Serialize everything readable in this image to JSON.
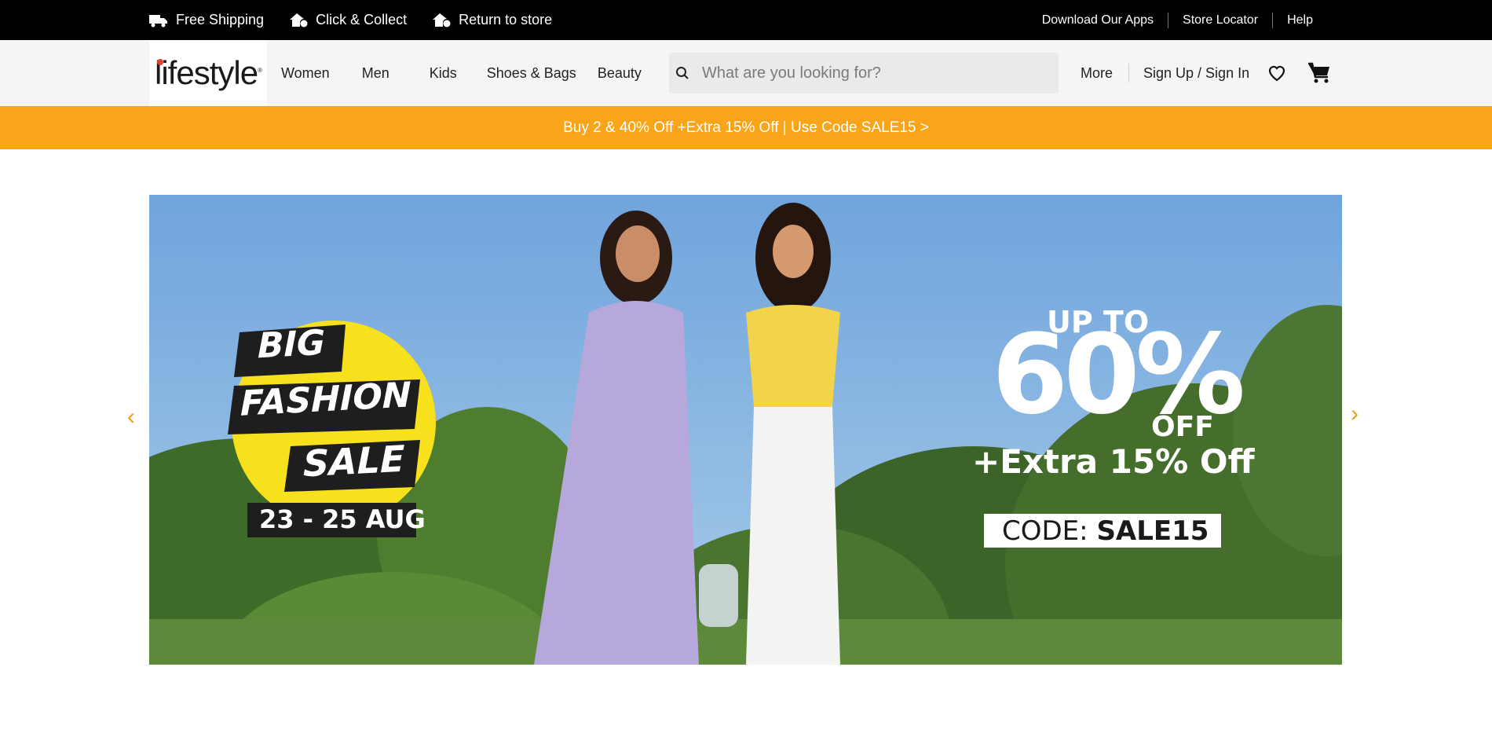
{
  "topbar": {
    "perks": [
      {
        "label": "Free Shipping",
        "icon": "truck-icon"
      },
      {
        "label": "Click & Collect",
        "icon": "home-check-icon"
      },
      {
        "label": "Return to store",
        "icon": "home-return-icon"
      }
    ],
    "links": [
      "Download Our Apps",
      "Store Locator",
      "Help"
    ]
  },
  "header": {
    "logo": "lifestyle",
    "nav": [
      "Women",
      "Men",
      "Kids",
      "Shoes & Bags",
      "Beauty"
    ],
    "search_placeholder": "What are you looking for?",
    "more": "More",
    "signin": "Sign Up / Sign In",
    "icons": [
      "heart-icon",
      "cart-icon"
    ]
  },
  "promo": {
    "text": "Buy 2 & 40% Off +Extra 15% Off | Use Code SALE15 >",
    "color": "#f9a51a"
  },
  "hero": {
    "badge_lines": [
      "BIG",
      "FASHION",
      "SALE"
    ],
    "dates": "23 - 25 AUG",
    "up_to": "UP TO",
    "percent": "60%",
    "off": "OFF",
    "extra": "+Extra 15% Off",
    "code_label": "CODE:",
    "code": "SALE15",
    "badge_color": "#f7e11c",
    "prev_arrow": "‹",
    "next_arrow": "›"
  }
}
